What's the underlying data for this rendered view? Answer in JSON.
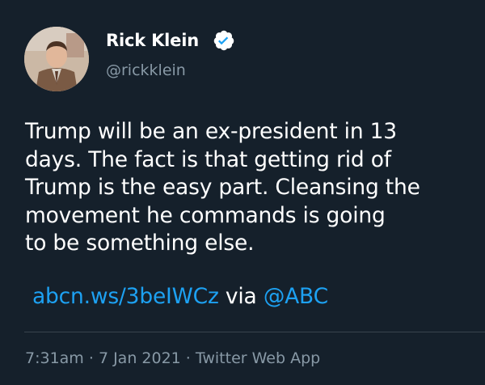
{
  "author": {
    "name": "Rick Klein",
    "handle": "@rickklein",
    "verified_icon": "verified-badge-icon",
    "avatar_icon": "profile-photo"
  },
  "tweet": {
    "lines": [
      "Trump will be an ex-president in 13",
      "days. The fact is that getting rid of",
      "Trump is the easy part. Cleansing the",
      "movement he commands is going",
      "to be something else."
    ],
    "link_text": "abcn.ws/3beIWCz",
    "via_text": " via ",
    "mention": "@ABC"
  },
  "meta": {
    "time": "7:31am",
    "sep1": " · ",
    "date": "7 Jan 2021",
    "sep2": " · ",
    "source": "Twitter Web App"
  },
  "colors": {
    "background": "#15202b",
    "link": "#1da1f2",
    "muted": "#8899a6",
    "text": "#ffffff"
  }
}
